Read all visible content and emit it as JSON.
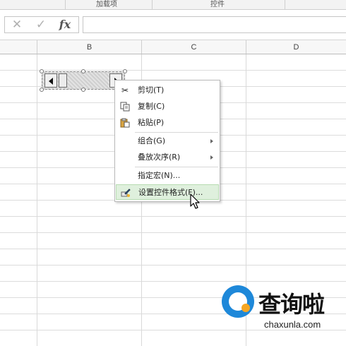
{
  "ribbon": {
    "groups": [
      "加载项",
      "控件"
    ]
  },
  "formula_bar": {
    "cancel_icon": "cancel-icon",
    "enter_icon": "enter-icon",
    "fx_label": "fx",
    "value": ""
  },
  "columns": [
    "B",
    "C",
    "D"
  ],
  "control": {
    "type": "scrollbar-form-control",
    "selected": true
  },
  "context_menu": {
    "items": [
      {
        "label": "剪切(T)",
        "icon": "scissors-icon"
      },
      {
        "label": "复制(C)",
        "icon": "copy-icon"
      },
      {
        "label": "粘贴(P)",
        "icon": "paste-icon"
      },
      {
        "label": "组合(G)",
        "submenu": true
      },
      {
        "label": "叠放次序(R)",
        "submenu": true
      },
      {
        "label": "指定宏(N)..."
      },
      {
        "label": "设置控件格式(F)...",
        "icon": "format-control-icon",
        "highlighted": true
      }
    ]
  },
  "watermark": {
    "title": "查询啦",
    "url": "chaxunla.com"
  },
  "colors": {
    "highlight": "#dff0dd",
    "logo_blue": "#1e88d9",
    "logo_orange": "#f5a623"
  }
}
